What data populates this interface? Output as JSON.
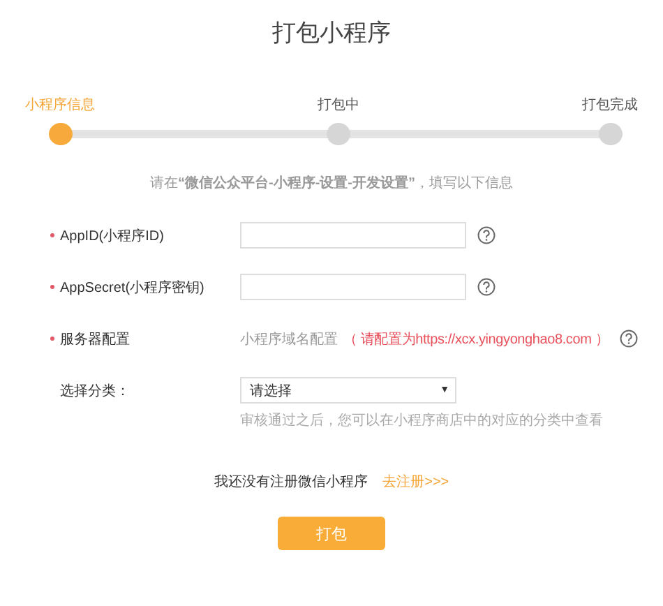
{
  "title": "打包小程序",
  "steps": [
    {
      "label": "小程序信息",
      "selected": true
    },
    {
      "label": "打包中",
      "selected": false
    },
    {
      "label": "打包完成",
      "selected": false
    }
  ],
  "hint": "请在**“微信公众平台-小程序-设置-开发设置”**，填写以下信息",
  "fields": [
    {
      "kind": "input",
      "label": "AppID(小程序ID)",
      "required": true,
      "help": true
    },
    {
      "kind": "input",
      "label": "AppSecret(小程序密钥)",
      "required": true,
      "help": true
    },
    {
      "kind": "info",
      "label": "服务器配置",
      "required": true,
      "help": true,
      "note": "小程序域名配置",
      "value": "（ 请配置为https://xcx.yingyonghao8.com ）"
    },
    {
      "kind": "select",
      "label": "选择分类：",
      "required": false,
      "help": false,
      "value": "请选择",
      "caret": "▼",
      "note": "审核通过之后，您可以在小程序商店中的对应的分类中查看"
    }
  ],
  "register": {
    "text": "我还没有注册微信小程序",
    "link": "去注册>>>"
  },
  "submit": "打包"
}
